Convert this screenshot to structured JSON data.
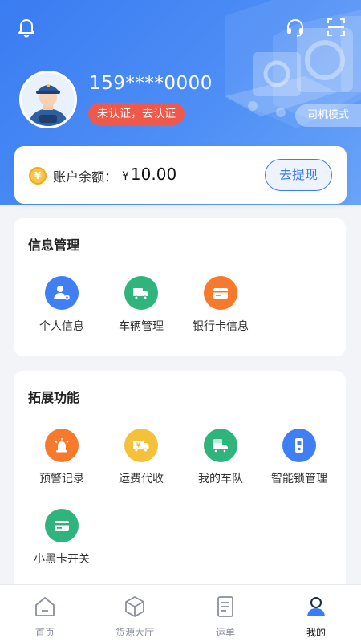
{
  "header": {
    "phone": "159****0000",
    "verify_label": "未认证，去认证",
    "mode_label": "司机模式",
    "icons": [
      "bell-icon",
      "headset-icon",
      "scan-icon"
    ]
  },
  "balance": {
    "label": "账户余额：",
    "currency": "¥",
    "amount": "10.00",
    "withdraw_label": "去提现"
  },
  "info_section": {
    "title": "信息管理",
    "items": [
      {
        "label": "个人信息",
        "icon": "person-settings-icon",
        "color": "#3f7ff3"
      },
      {
        "label": "车辆管理",
        "icon": "truck-icon",
        "color": "#2fb57c"
      },
      {
        "label": "银行卡信息",
        "icon": "bank-card-icon",
        "color": "#f77a2c"
      }
    ]
  },
  "ext_section": {
    "title": "拓展功能",
    "items": [
      {
        "label": "预警记录",
        "icon": "alarm-light-icon",
        "color": "#f77a2c"
      },
      {
        "label": "运费代收",
        "icon": "yen-truck-icon",
        "color": "#f6c13a"
      },
      {
        "label": "我的车队",
        "icon": "fleet-icon",
        "color": "#2fb57c"
      },
      {
        "label": "智能锁管理",
        "icon": "smart-lock-icon",
        "color": "#3f7ff3"
      },
      {
        "label": "小黑卡开关",
        "icon": "card-icon",
        "color": "#2fb57c"
      }
    ]
  },
  "tabbar": {
    "items": [
      {
        "label": "首页",
        "icon": "home-icon"
      },
      {
        "label": "货源大厅",
        "icon": "cargo-box-icon"
      },
      {
        "label": "运单",
        "icon": "waybill-icon"
      },
      {
        "label": "我的",
        "icon": "profile-icon",
        "active": true
      }
    ]
  },
  "colors": {
    "brand_blue": "#3a7cf2",
    "verify_red": "#f0594a",
    "page_bg": "#f2f4f8"
  }
}
